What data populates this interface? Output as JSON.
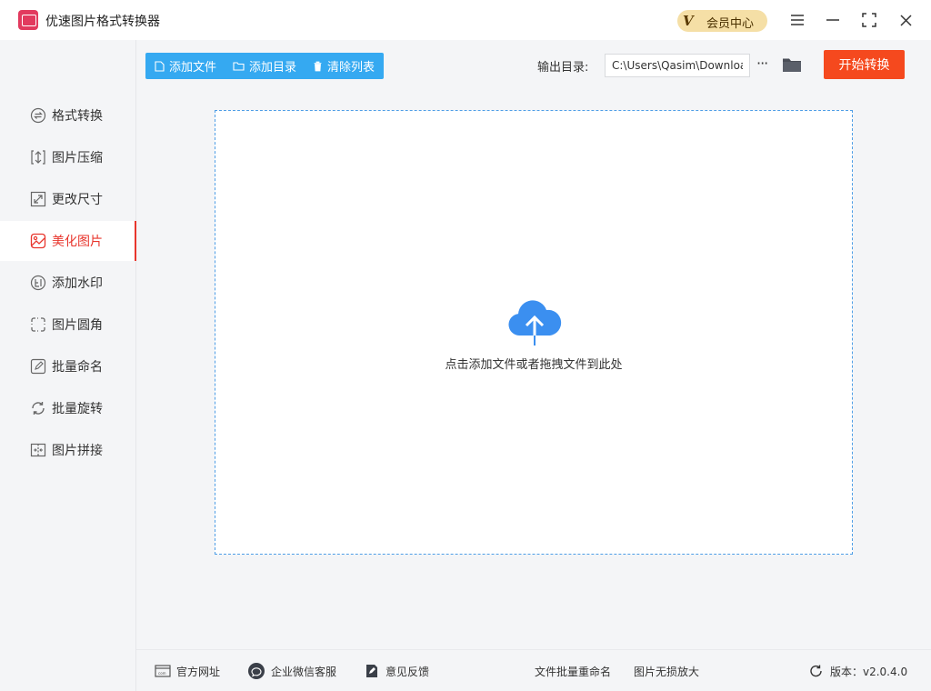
{
  "app": {
    "title": "优速图片格式转换器"
  },
  "header": {
    "vip": {
      "badge": "V",
      "label": "会员中心"
    },
    "window_controls": {
      "menu_icon": "menu-icon",
      "minimize_icon": "minimize-icon",
      "maximize_icon": "maximize-icon",
      "close_icon": "close-icon"
    }
  },
  "sidebar": {
    "items": [
      {
        "label": "格式转换",
        "icon": "format-convert-icon",
        "active": false
      },
      {
        "label": "图片压缩",
        "icon": "compress-icon",
        "active": false
      },
      {
        "label": "更改尺寸",
        "icon": "resize-icon",
        "active": false
      },
      {
        "label": "美化图片",
        "icon": "beautify-icon",
        "active": true
      },
      {
        "label": "添加水印",
        "icon": "watermark-icon",
        "active": false
      },
      {
        "label": "图片圆角",
        "icon": "round-corner-icon",
        "active": false
      },
      {
        "label": "批量命名",
        "icon": "rename-icon",
        "active": false
      },
      {
        "label": "批量旋转",
        "icon": "rotate-icon",
        "active": false
      },
      {
        "label": "图片拼接",
        "icon": "stitch-icon",
        "active": false
      }
    ]
  },
  "toolbar": {
    "add_file": "添加文件",
    "add_dir": "添加目录",
    "clear_list": "清除列表",
    "output_label": "输出目录:",
    "output_path": "C:\\Users\\Qasim\\Downloads",
    "more": "···",
    "start": "开始转换"
  },
  "dropzone": {
    "text": "点击添加文件或者拖拽文件到此处"
  },
  "footer": {
    "website": "官方网址",
    "wechat": "企业微信客服",
    "feedback": "意见反馈",
    "batch_rename": "文件批量重命名",
    "enlarge": "图片无损放大",
    "version": "版本：v2.0.4.0"
  },
  "colors": {
    "accent": "#e8362d",
    "start_button": "#f5491e",
    "toolbar": "#35a9f1",
    "vip": "#f5dfa6",
    "dropzone_border": "#4e9ee6"
  }
}
